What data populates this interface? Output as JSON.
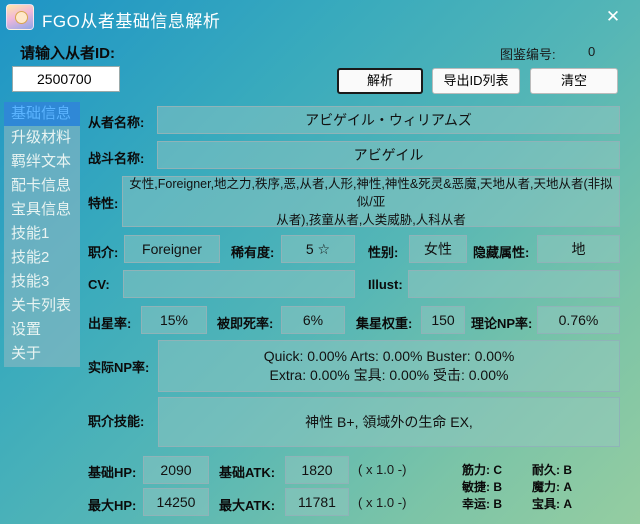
{
  "window": {
    "title": "FGO从者基础信息解析",
    "close_glyph": "✕"
  },
  "search": {
    "label": "请输入从者ID:",
    "value": "2500700",
    "collection_label": "图鉴编号:",
    "collection_value": "0"
  },
  "buttons": {
    "parse": "解析",
    "export": "导出ID列表",
    "clear": "清空"
  },
  "nav": {
    "items": [
      {
        "label": "基础信息",
        "active": true
      },
      {
        "label": "升级材料"
      },
      {
        "label": "羁绊文本"
      },
      {
        "label": "配卡信息"
      },
      {
        "label": "宝具信息"
      },
      {
        "label": "技能1"
      },
      {
        "label": "技能2"
      },
      {
        "label": "技能3"
      },
      {
        "label": "关卡列表"
      },
      {
        "label": "设置"
      },
      {
        "label": "关于"
      }
    ]
  },
  "info": {
    "name_label": "从者名称:",
    "name_value": "アビゲイル・ウィリアムズ",
    "battle_name_label": "战斗名称:",
    "battle_name_value": "アビゲイル",
    "traits_label": "特性:",
    "traits_line1": "女性,Foreigner,地之力,秩序,恶,从者,人形,神性,神性&死灵&恶魔,天地从者,天地从者(非拟似/亚",
    "traits_line2": "从者),孩童从者,人类威胁,人科从者",
    "class_label": "职介:",
    "class_value": "Foreigner",
    "rarity_label": "稀有度:",
    "rarity_value": "5 ☆",
    "gender_label": "性别:",
    "gender_value": "女性",
    "hidden_attr_label": "隐藏属性:",
    "hidden_attr_value": "地",
    "cv_label": "CV:",
    "cv_value": "",
    "illust_label": "Illust:",
    "illust_value": "",
    "star_rate_label": "出星率:",
    "star_rate_value": "15%",
    "death_rate_label": "被即死率:",
    "death_rate_value": "6%",
    "star_weight_label": "集星权重:",
    "star_weight_value": "150",
    "np_theory_label": "理论NP率:",
    "np_theory_value": "0.76%",
    "np_actual_label": "实际NP率:",
    "np_actual_line1": "Quick: 0.00%   Arts: 0.00%   Buster: 0.00%",
    "np_actual_line2": "Extra: 0.00%   宝具: 0.00%   受击: 0.00%",
    "class_skill_label": "职介技能:",
    "class_skill_value": "神性 B+, 領域外の生命 EX,",
    "base_hp_label": "基础HP:",
    "base_hp_value": "2090",
    "base_atk_label": "基础ATK:",
    "base_atk_value": "1820",
    "base_mult": "( x 1.0 -)",
    "max_hp_label": "最大HP:",
    "max_hp_value": "14250",
    "max_atk_label": "最大ATK:",
    "max_atk_value": "11781",
    "max_mult": "( x 1.0 -)"
  },
  "params": {
    "strength": "筋力: C",
    "endurance": "耐久: B",
    "agility": "敏捷: B",
    "mana": "魔力: A",
    "luck": "幸运: B",
    "np": "宝具: A"
  }
}
